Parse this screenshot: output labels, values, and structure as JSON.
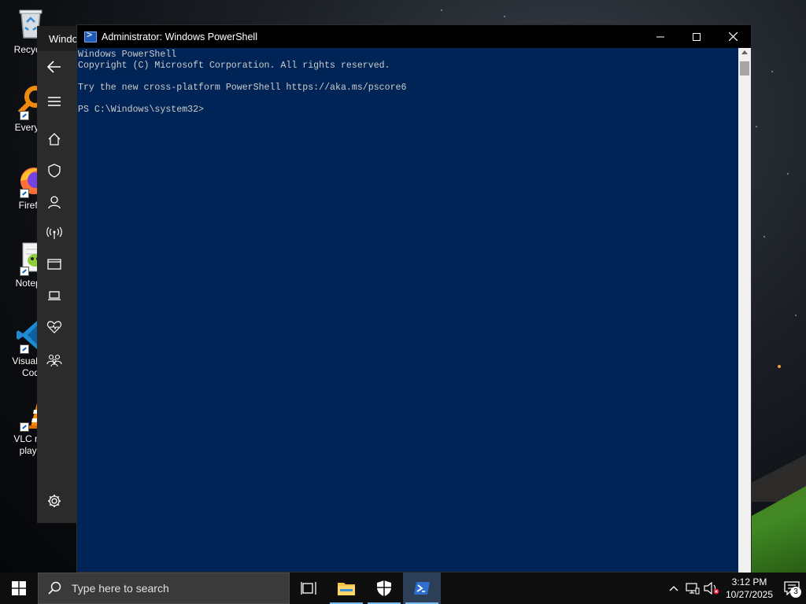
{
  "desktop": {
    "icons": [
      {
        "label": "Recycle",
        "icon": "recycle-bin-icon"
      },
      {
        "label": "Everyth",
        "icon": "everything-search-icon"
      },
      {
        "label": "Firefo",
        "icon": "firefox-icon"
      },
      {
        "label": "Notepa",
        "icon": "notepad-plus-plus-icon"
      },
      {
        "label": "Visual St",
        "label2": "Cod",
        "icon": "vscode-icon"
      },
      {
        "label": "VLC me",
        "label2": "playe",
        "icon": "vlc-icon"
      }
    ]
  },
  "settings_window": {
    "title": "Windo",
    "nav": [
      {
        "icon": "back-arrow-icon"
      },
      {
        "icon": "hamburger-menu-icon"
      },
      {
        "icon": "home-icon"
      },
      {
        "icon": "shield-icon"
      },
      {
        "icon": "person-icon"
      },
      {
        "icon": "antenna-icon"
      },
      {
        "icon": "app-browser-icon"
      },
      {
        "icon": "laptop-icon"
      },
      {
        "icon": "heart-pulse-icon"
      },
      {
        "icon": "family-icon"
      },
      {
        "icon": "gear-icon"
      }
    ]
  },
  "powershell": {
    "title": "Administrator: Windows PowerShell",
    "lines": [
      "Windows PowerShell",
      "Copyright (C) Microsoft Corporation. All rights reserved.",
      "",
      "Try the new cross-platform PowerShell https://aka.ms/pscore6",
      "",
      "PS C:\\Windows\\system32>"
    ],
    "colors": {
      "background": "#012456",
      "text": "#cccccc"
    }
  },
  "taskbar": {
    "search_placeholder": "Type here to search",
    "pinned": [
      {
        "icon": "task-view-icon"
      },
      {
        "icon": "file-explorer-icon"
      },
      {
        "icon": "windows-security-icon"
      },
      {
        "icon": "powershell-icon"
      }
    ],
    "clock": {
      "time": "3:12 PM",
      "date": "10/27/2025"
    },
    "notifications_count": "3"
  }
}
